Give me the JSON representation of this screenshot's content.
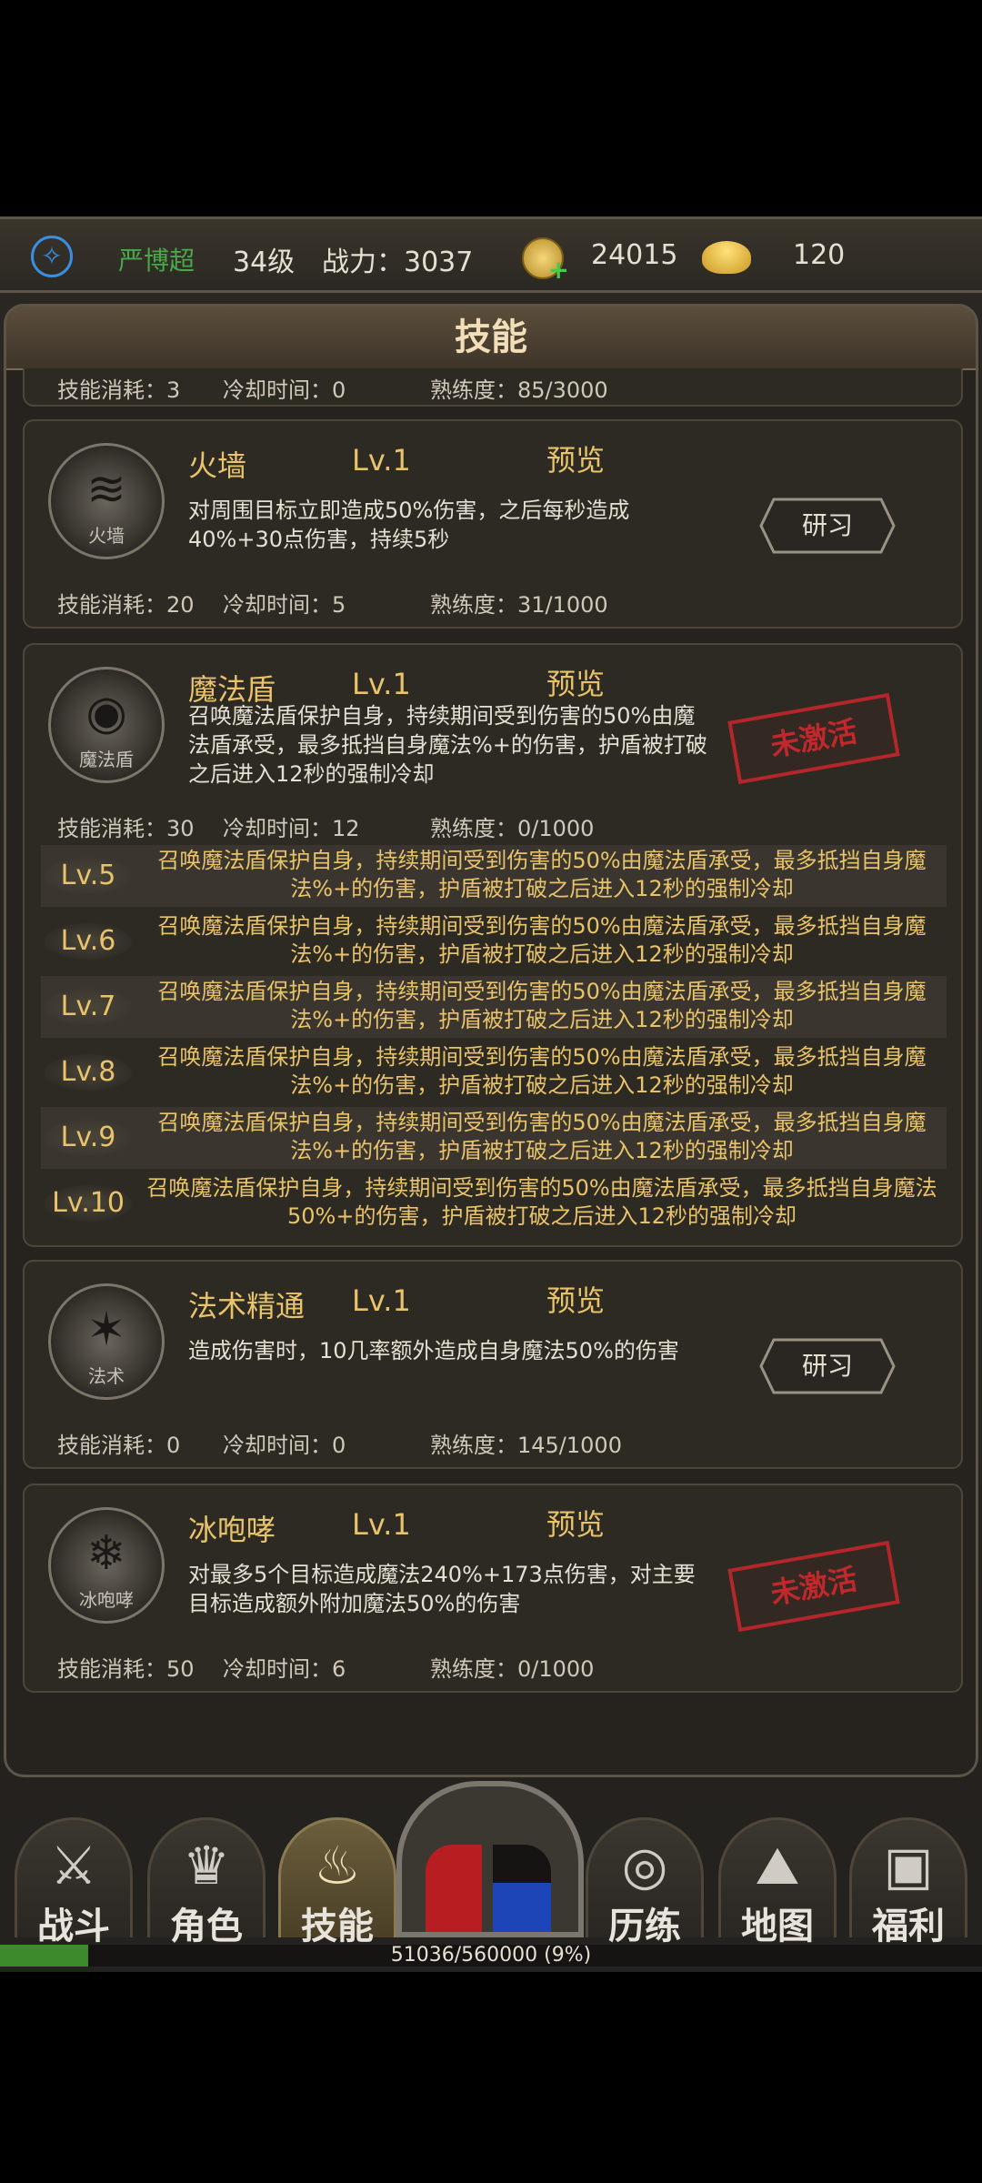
{
  "status": {
    "player_name": "严博超",
    "level": "34级",
    "power": "战力：3037",
    "coins": "24015",
    "ingots": "120"
  },
  "panel": {
    "title": "技能"
  },
  "prev_card_stats": {
    "cost": "技能消耗：3",
    "cooldown": "冷却时间：0",
    "mastery": "熟练度：85/3000"
  },
  "skills": [
    {
      "name": "火墙",
      "level": "Lv.1",
      "preview": "预览",
      "icon_caption": "火墙",
      "icon": "fire-wall-icon",
      "desc": "对周围目标立即造成50%伤害，之后每秒造成40%+30点伤害，持续5秒",
      "cost": "技能消耗：20",
      "cooldown": "冷却时间：5",
      "mastery": "熟练度：31/1000",
      "action": "研习"
    },
    {
      "name": "魔法盾",
      "level": "Lv.1",
      "preview": "预览",
      "icon_caption": "魔法盾",
      "icon": "magic-shield-icon",
      "desc": "召唤魔法盾保护自身，持续期间受到伤害的50%由魔法盾承受，最多抵挡自身魔法%+的伤害，护盾被打破之后进入12秒的强制冷却",
      "cost": "技能消耗：30",
      "cooldown": "冷却时间：12",
      "mastery": "熟练度：0/1000",
      "stamp": "未激活",
      "levels": [
        {
          "lv": "Lv.5",
          "text": "召唤魔法盾保护自身，持续期间受到伤害的50%由魔法盾承受，最多抵挡自身魔法%+的伤害，护盾被打破之后进入12秒的强制冷却"
        },
        {
          "lv": "Lv.6",
          "text": "召唤魔法盾保护自身，持续期间受到伤害的50%由魔法盾承受，最多抵挡自身魔法%+的伤害，护盾被打破之后进入12秒的强制冷却"
        },
        {
          "lv": "Lv.7",
          "text": "召唤魔法盾保护自身，持续期间受到伤害的50%由魔法盾承受，最多抵挡自身魔法%+的伤害，护盾被打破之后进入12秒的强制冷却"
        },
        {
          "lv": "Lv.8",
          "text": "召唤魔法盾保护自身，持续期间受到伤害的50%由魔法盾承受，最多抵挡自身魔法%+的伤害，护盾被打破之后进入12秒的强制冷却"
        },
        {
          "lv": "Lv.9",
          "text": "召唤魔法盾保护自身，持续期间受到伤害的50%由魔法盾承受，最多抵挡自身魔法%+的伤害，护盾被打破之后进入12秒的强制冷却"
        },
        {
          "lv": "Lv.10",
          "text": "召唤魔法盾保护自身，持续期间受到伤害的50%由魔法盾承受，最多抵挡自身魔法50%+的伤害，护盾被打破之后进入12秒的强制冷却"
        }
      ]
    },
    {
      "name": "法术精通",
      "level": "Lv.1",
      "preview": "预览",
      "icon_caption": "法术",
      "icon": "spell-mastery-icon",
      "desc": "造成伤害时，10几率额外造成自身魔法50%的伤害",
      "cost": "技能消耗：0",
      "cooldown": "冷却时间：0",
      "mastery": "熟练度：145/1000",
      "action": "研习"
    },
    {
      "name": "冰咆哮",
      "level": "Lv.1",
      "preview": "预览",
      "icon_caption": "冰咆哮",
      "icon": "snowflake-icon",
      "desc": "对最多5个目标造成魔法240%+173点伤害，对主要目标造成额外附加魔法50%的伤害",
      "cost": "技能消耗：50",
      "cooldown": "冷却时间：6",
      "mastery": "熟练度：0/1000",
      "stamp": "未激活"
    }
  ],
  "nav": {
    "tabs": [
      {
        "label": "战斗",
        "icon": "crossed-swords-icon"
      },
      {
        "label": "角色",
        "icon": "helmet-icon"
      },
      {
        "label": "技能",
        "icon": "flame-icon"
      },
      {
        "label": "历练",
        "icon": "swirl-icon"
      },
      {
        "label": "地图",
        "icon": "map-pin-icon"
      },
      {
        "label": "福利",
        "icon": "chest-icon"
      }
    ],
    "active": "技能"
  },
  "xp": {
    "text": "51036/560000 (9%)",
    "fraction": 0.09
  }
}
